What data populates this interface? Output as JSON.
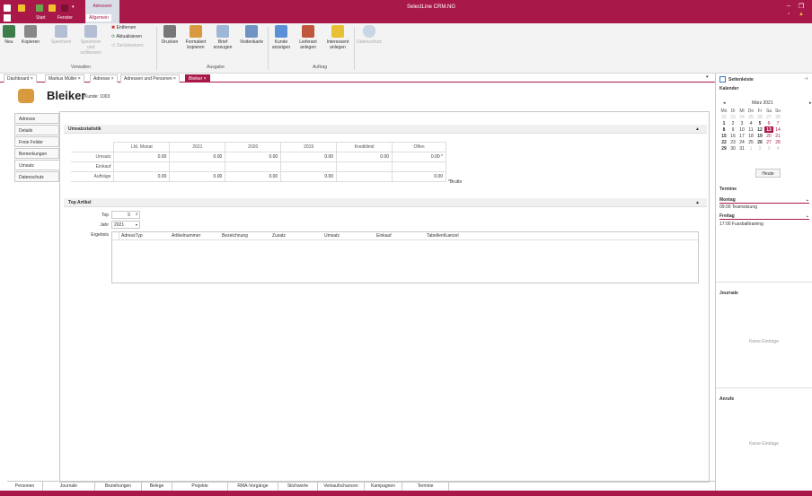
{
  "titlebar": {
    "app_title": "SelectLine CRM.NG",
    "context_tab": "Adressen",
    "tabs": [
      "Start",
      "Fenster",
      "Allgemein"
    ],
    "qa_colors": [
      "#ffffff",
      "#f2c12e",
      "#6aa84f",
      "#f2c12e",
      "#a8194a"
    ]
  },
  "ribbon": {
    "verwalten": {
      "neu": "Neu",
      "kopieren": "Kopieren",
      "speichern": "Speichern",
      "speichern_schliessen": "Speichern und schliessen",
      "entfernen": "Entfernen",
      "aktualisieren": "Aktualisieren",
      "zuruecksetzen": "Zurücksetzen",
      "label": "Verwalten"
    },
    "ausgabe": {
      "drucken": "Drucken",
      "formatiert_kopieren": "Formatiert kopieren",
      "brief_erzeugen": "Brief erzeugen",
      "visitenkarte": "Visitenkarte",
      "label": "Ausgabe"
    },
    "auftrag": {
      "kunde_anzeigen": "Kunde anzeigen",
      "lieferant_anlegen": "Lieferant anlegen",
      "interessent_anlegen": "Interessent anlegen",
      "label": "Auftrag"
    },
    "datenschutz": "Datenschutz"
  },
  "doctabs": [
    "Dashboard",
    "Markus Müller",
    "Adresse",
    "Adressen und Personen",
    "Bleiker"
  ],
  "header": {
    "name": "Bleiker",
    "kunde_label": "Kunde:",
    "kunde_nr": "1003"
  },
  "navtabs": [
    "Adresse",
    "Details",
    "Freie Felder",
    "Bemerkungen",
    "Umsatz",
    "Datenschutz"
  ],
  "umsatz": {
    "title": "Umsatzstatistik",
    "columns": [
      "Lfd. Monat",
      "2021",
      "2020",
      "2019",
      "Kreditlimit",
      "Offen"
    ],
    "rows": [
      {
        "label": "Umsatz",
        "values": [
          "0.00",
          "0.00",
          "0.00",
          "0.00",
          "0.00",
          "0.00 *"
        ]
      },
      {
        "label": "Einkauf",
        "values": [
          "",
          "",
          "",
          "",
          "",
          ""
        ]
      },
      {
        "label": "Aufträge",
        "values": [
          "0.00",
          "0.00",
          "0.00",
          "0.00",
          "",
          "0.00"
        ]
      }
    ],
    "brutto_note": "*Brutto"
  },
  "top_artikel": {
    "title": "Top Artikel",
    "top_label": "Top",
    "top_value": "5",
    "jahr_label": "Jahr",
    "jahr_value": "2021",
    "ergebnis_label": "Ergebnis",
    "columns": [
      "AdressTyp",
      "Artikelnummer",
      "Bezeichnung",
      "Zusatz",
      "Umsatz",
      "Einkauf",
      "TabellenKuerzel"
    ]
  },
  "bottomtabs": [
    "Personen",
    "Journale",
    "Beziehungen",
    "Belege",
    "Projekte",
    "RMA-Vorgänge",
    "Stichworte",
    "Verkaufschancen",
    "Kampagnen",
    "Termine"
  ],
  "sidebar": {
    "title": "Seitenleiste",
    "kalender": "Kalender",
    "month": "März 2021",
    "weekdays": [
      "Mo",
      "Di",
      "Mi",
      "Do",
      "Fr",
      "Sa",
      "So"
    ],
    "weeks": [
      [
        "22",
        "23",
        "24",
        "25",
        "26",
        "27",
        "28"
      ],
      [
        "1",
        "2",
        "3",
        "4",
        "5",
        "6",
        "7"
      ],
      [
        "8",
        "9",
        "10",
        "11",
        "12",
        "13",
        "14"
      ],
      [
        "15",
        "16",
        "17",
        "18",
        "19",
        "20",
        "21"
      ],
      [
        "22",
        "23",
        "24",
        "25",
        "26",
        "27",
        "28"
      ],
      [
        "29",
        "30",
        "31",
        "1",
        "2",
        "3",
        "4"
      ]
    ],
    "heute": "Heute",
    "termine": "Termine",
    "montag": "Montag",
    "montag_entry": "09:00 Teamsitzung",
    "freitag": "Freitag",
    "freitag_entry": "17:00 Fussballtraining",
    "journale": "Journale",
    "keine1": "Keine Einträge",
    "anrufe": "Anrufe",
    "keine2": "Keine Einträge"
  },
  "colors": {
    "accent": "#a8194a",
    "ribbon_bg": "#f3f3f3",
    "today": "#a8194a"
  }
}
